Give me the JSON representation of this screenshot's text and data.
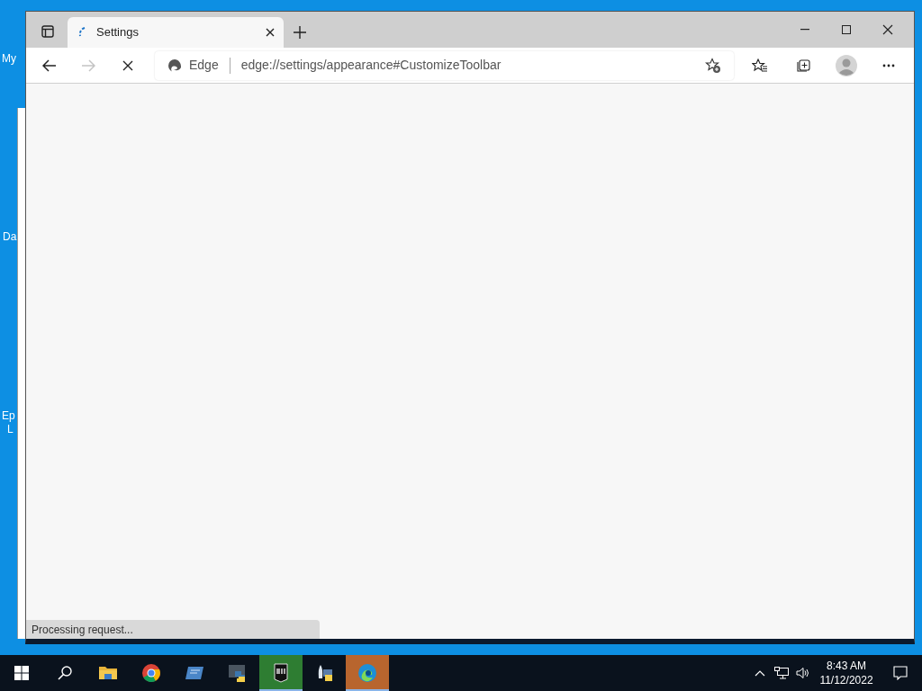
{
  "desktop": {
    "icon_labels": [
      "My",
      "Da",
      "Ep",
      "L"
    ]
  },
  "browser": {
    "tabs": [
      {
        "title": "Settings",
        "selected": true,
        "loading": true
      }
    ],
    "nav": {
      "back_disabled": false,
      "forward_disabled": true,
      "loading": true
    },
    "address": {
      "site_label": "Edge",
      "url": "edge://settings/appearance#CustomizeToolbar"
    },
    "status": "Processing request..."
  },
  "taskbar": {
    "apps": [
      {
        "kind": "explorer",
        "active": false
      },
      {
        "kind": "chrome",
        "active": false
      },
      {
        "kind": "remote",
        "active": false
      },
      {
        "kind": "python",
        "active": false
      },
      {
        "kind": "epic",
        "active": true,
        "color": "#2e7d32"
      },
      {
        "kind": "pyapp",
        "active": false
      },
      {
        "kind": "edge",
        "active": true,
        "color": "#b8652e"
      }
    ],
    "time": "8:43 AM",
    "date": "11/12/2022"
  }
}
